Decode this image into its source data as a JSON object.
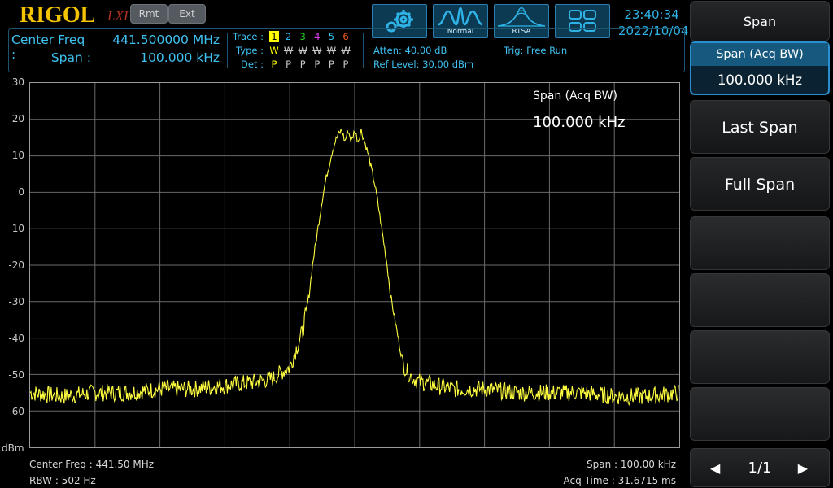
{
  "brand": {
    "logo": "RIGOL",
    "lxi": "LXI",
    "rmt": "Rmt",
    "ext": "Ext"
  },
  "modes": [
    {
      "icon": "gear-icon",
      "label": ""
    },
    {
      "icon": "normal-mode-icon",
      "label": "Normal"
    },
    {
      "icon": "rtsa-mode-icon",
      "label": "RTSA"
    },
    {
      "icon": "window-layout-icon",
      "label": ""
    }
  ],
  "clock": {
    "time": "23:40:34",
    "date": "2022/10/04"
  },
  "info": {
    "center_label": "Center Freq :",
    "center_value": "441.500000 MHz",
    "span_label": "Span :",
    "span_value": "100.000 kHz",
    "trace_label": "Trace :",
    "type_label": "Type :",
    "det_label": "Det :",
    "trace_numbers": [
      "1",
      "2",
      "3",
      "4",
      "5",
      "6"
    ],
    "trace_colors": [
      "#ffff00",
      "#26b5f0",
      "#22d022",
      "#e040f0",
      "#30c0f0",
      "#f06020"
    ],
    "types": [
      "W",
      "W",
      "W",
      "W",
      "W",
      "W"
    ],
    "dets": [
      "P",
      "P",
      "P",
      "P",
      "P",
      "P"
    ],
    "atten": "Atten: 40.00 dB",
    "ref_level": "Ref Level: 30.00 dBm",
    "trig": "Trig: Free Run"
  },
  "overlay": {
    "title": "Span (Acq BW)",
    "value": "100.000 kHz"
  },
  "axis": {
    "y_ticks": [
      "30",
      "20",
      "10",
      "0",
      "-10",
      "-20",
      "-30",
      "-40",
      "-50",
      "-60"
    ],
    "unit": "dBm"
  },
  "bottom": {
    "center": "Center Freq : 441.50 MHz",
    "rbw": "RBW : 502 Hz",
    "span": "Span : 100.00 kHz",
    "acq_time": "Acq Time : 31.6715 ms"
  },
  "softkeys": {
    "title": "Span",
    "span_acq_label": "Span (Acq BW)",
    "span_acq_value": "100.000 kHz",
    "last_span": "Last Span",
    "full_span": "Full Span",
    "page": "1/1"
  },
  "chart_data": {
    "type": "line",
    "xlabel": "",
    "ylabel": "dBm",
    "ylim": [
      -70,
      30
    ],
    "xlim": [
      441.45,
      441.55
    ],
    "grid": true,
    "series": [
      {
        "color": "#ffff40",
        "x": [
          441.45,
          441.455,
          441.46,
          441.465,
          441.47,
          441.475,
          441.48,
          441.485,
          441.4875,
          441.489,
          441.49,
          441.491,
          441.492,
          441.4925,
          441.493,
          441.4935,
          441.494,
          441.4945,
          441.495,
          441.4955,
          441.496,
          441.4965,
          441.497,
          441.4975,
          441.498,
          441.4985,
          441.499,
          441.4995,
          441.5,
          441.5005,
          441.501,
          441.5015,
          441.502,
          441.5025,
          441.503,
          441.5035,
          441.504,
          441.5045,
          441.505,
          441.5055,
          441.506,
          441.5065,
          441.507,
          441.5075,
          441.508,
          441.509,
          441.51,
          441.5125,
          441.515,
          441.52,
          441.525,
          441.53,
          441.535,
          441.54,
          441.545,
          441.55
        ],
        "y": [
          -55,
          -56,
          -55,
          -55,
          -54,
          -54,
          -53,
          -52,
          -51,
          -49,
          -48,
          -43,
          -38,
          -33,
          -28,
          -20,
          -14,
          -8,
          -2,
          3,
          7,
          11,
          14,
          16,
          17,
          14,
          17,
          14,
          17,
          14,
          17,
          14,
          11,
          7,
          3,
          -2,
          -8,
          -14,
          -20,
          -28,
          -33,
          -38,
          -43,
          -47,
          -49,
          -51,
          -52,
          -53,
          -54,
          -54,
          -55,
          -55,
          -55,
          -56,
          -56,
          -55
        ]
      }
    ]
  }
}
